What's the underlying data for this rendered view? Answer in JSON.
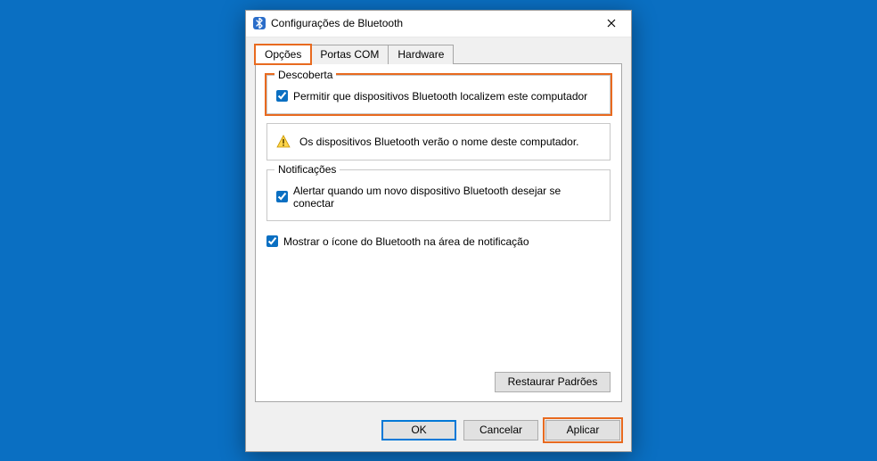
{
  "window": {
    "title": "Configurações de Bluetooth"
  },
  "tabs": {
    "items": [
      {
        "label": "Opções",
        "active": true,
        "highlight": true
      },
      {
        "label": "Portas COM",
        "active": false,
        "highlight": false
      },
      {
        "label": "Hardware",
        "active": false,
        "highlight": false
      }
    ]
  },
  "discovery": {
    "legend": "Descoberta",
    "checkbox_label": "Permitir que dispositivos Bluetooth localizem este computador",
    "checked": true,
    "info_text": "Os dispositivos Bluetooth verão o nome deste computador."
  },
  "notifications": {
    "legend": "Notificações",
    "checkbox_label": "Alertar quando um novo dispositivo Bluetooth desejar se conectar",
    "checked": true
  },
  "tray": {
    "checkbox_label": "Mostrar o ícone do Bluetooth na área de notificação",
    "checked": true
  },
  "buttons": {
    "restore_defaults": "Restaurar Padrões",
    "ok": "OK",
    "cancel": "Cancelar",
    "apply": "Aplicar"
  }
}
